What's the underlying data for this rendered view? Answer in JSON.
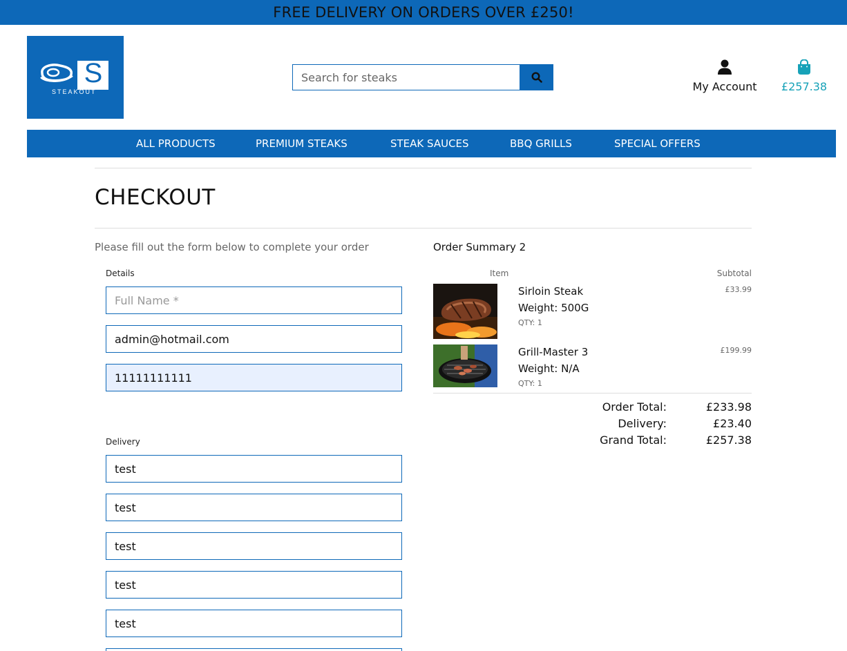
{
  "banner": {
    "text": "FREE DELIVERY ON ORDERS OVER £250!"
  },
  "header": {
    "logo_letter": "S",
    "logo_word": "STEAKOUT",
    "search_placeholder": "Search for steaks",
    "account_label": "My Account",
    "bag_total": "£257.38"
  },
  "nav": {
    "items": [
      "ALL PRODUCTS",
      "PREMIUM STEAKS",
      "STEAK SAUCES",
      "BBQ GRILLS",
      "SPECIAL OFFERS"
    ]
  },
  "checkout": {
    "title": "CHECKOUT",
    "intro": "Please fill out the form below to complete your order",
    "details_label": "Details",
    "full_name_placeholder": "Full Name *",
    "email_value": "admin@hotmail.com",
    "phone_value": "11111111111",
    "delivery_label": "Delivery",
    "delivery_values": [
      "test",
      "test",
      "test",
      "test",
      "test"
    ]
  },
  "summary": {
    "title": "Order Summary 2",
    "col_item": "Item",
    "col_subtotal": "Subtotal",
    "items": [
      {
        "name": "Sirloin Steak",
        "weight": "Weight: 500G",
        "qty": "QTY: 1",
        "price": "£33.99"
      },
      {
        "name": "Grill-Master 3",
        "weight": "Weight: N/A",
        "qty": "QTY: 1",
        "price": "£199.99"
      }
    ],
    "order_total_label": "Order Total:",
    "order_total": "£233.98",
    "delivery_label": "Delivery:",
    "delivery": "£23.40",
    "grand_total_label": "Grand Total:",
    "grand_total": "£257.38"
  },
  "colors": {
    "brand_blue": "#0d68b8",
    "bag_teal": "#17a2b8",
    "autofill": "#e8f0fe"
  },
  "icons": [
    "search-icon",
    "user-icon",
    "shopping-bag-icon"
  ]
}
